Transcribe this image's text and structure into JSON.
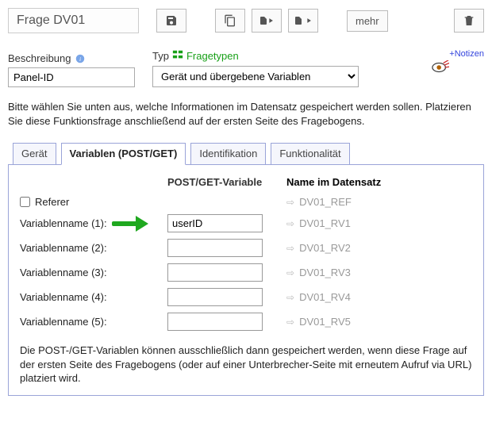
{
  "header": {
    "title": "Frage DV01",
    "more_label": "mehr"
  },
  "desc": {
    "label": "Beschreibung",
    "value": "Panel-ID"
  },
  "type": {
    "label": "Typ",
    "link": "Fragetypen",
    "selected": "Gerät und übergebene Variablen"
  },
  "notes_link": "+Notizen",
  "explain_text": "Bitte wählen Sie unten aus, welche Informationen im Datensatz gespeichert werden sollen. Platzieren Sie diese Funktionsfrage anschließend auf der ersten Seite des Fragebogens.",
  "tabs": {
    "t0": "Gerät",
    "t1": "Variablen (POST/GET)",
    "t2": "Identifikation",
    "t3": "Funktionalität",
    "active": 1
  },
  "panel": {
    "head_var": "POST/GET-Variable",
    "head_ds": "Name im Datensatz",
    "referer_label": "Referer",
    "referer_checked": false,
    "rows": [
      {
        "label": "Variablenname (1):",
        "value": "userID",
        "ds": "DV01_RV1",
        "arrow": true
      },
      {
        "label": "Variablenname (2):",
        "value": "",
        "ds": "DV01_RV2",
        "arrow": false
      },
      {
        "label": "Variablenname (3):",
        "value": "",
        "ds": "DV01_RV3",
        "arrow": false
      },
      {
        "label": "Variablenname (4):",
        "value": "",
        "ds": "DV01_RV4",
        "arrow": false
      },
      {
        "label": "Variablenname (5):",
        "value": "",
        "ds": "DV01_RV5",
        "arrow": false
      }
    ],
    "referer_ds": "DV01_REF",
    "note": "Die POST-/GET-Variablen können ausschließlich dann gespeichert werden, wenn diese Frage auf der ersten Seite des Fragebogens (oder auf einer Unterbrecher-Seite mit erneutem Aufruf via URL) platziert wird."
  }
}
